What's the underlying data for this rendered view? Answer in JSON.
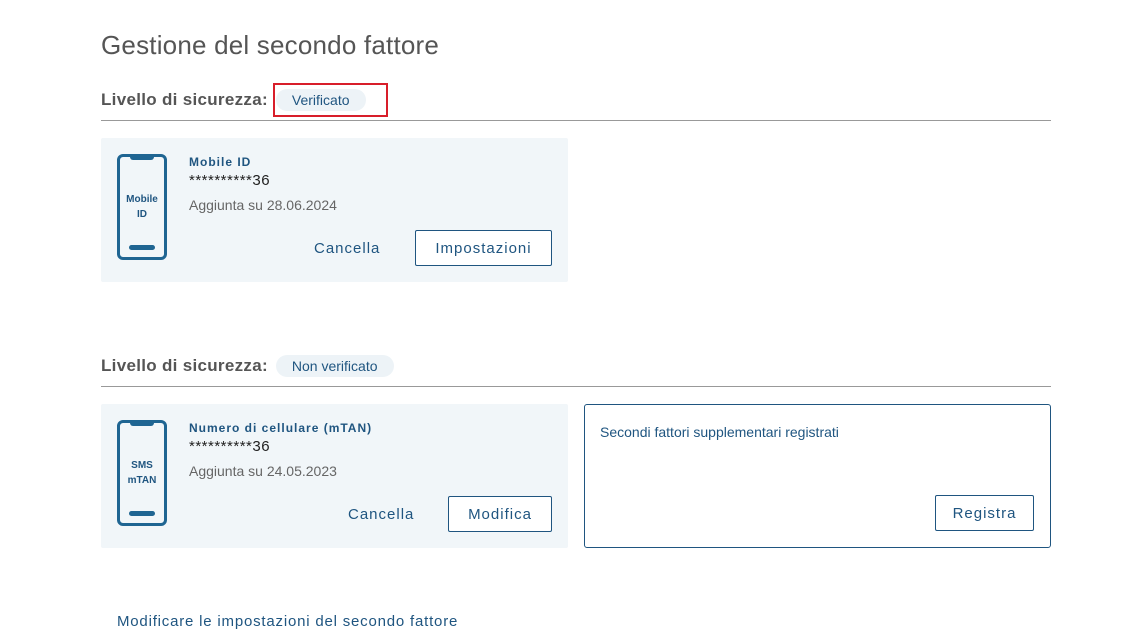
{
  "page": {
    "title": "Gestione del secondo fattore"
  },
  "section_verified": {
    "level_label": "Livello di sicurezza:",
    "badge": "Verificato",
    "card": {
      "icon_label_line1": "Mobile",
      "icon_label_line2": "ID",
      "title": "Mobile ID",
      "number": "**********36",
      "date": "Aggiunta su 28.06.2024",
      "cancel_label": "Cancella",
      "settings_label": "Impostazioni"
    }
  },
  "section_unverified": {
    "level_label": "Livello di sicurezza:",
    "badge": "Non verificato",
    "card": {
      "icon_label_line1": "SMS",
      "icon_label_line2": "mTAN",
      "title": "Numero di cellulare (mTAN)",
      "number": "**********36",
      "date": "Aggiunta su 24.05.2023",
      "cancel_label": "Cancella",
      "edit_label": "Modifica"
    },
    "extra": {
      "title": "Secondi fattori supplementari registrati",
      "register_label": "Registra"
    }
  },
  "footer": {
    "link": "Modificare le impostazioni del secondo fattore"
  },
  "colors": {
    "accent": "#1f5580",
    "highlight": "#d81e2a",
    "card_bg": "#f1f6f9"
  }
}
